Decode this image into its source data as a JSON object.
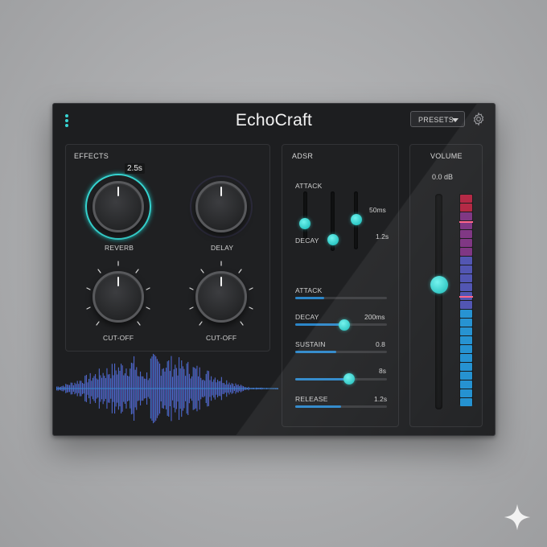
{
  "app": {
    "title": "EchoCraft"
  },
  "header": {
    "presets_label": "PRESETS"
  },
  "effects": {
    "title": "EFFECTS",
    "knobs": [
      {
        "label": "REVERB",
        "value_tooltip": "2.5s",
        "active": true
      },
      {
        "label": "DELAY",
        "active": false
      },
      {
        "label": "CUT-OFF",
        "active": false
      },
      {
        "label": "CUT-OFF",
        "active": false
      }
    ]
  },
  "adsr": {
    "title": "ADSR",
    "vertical": {
      "attack_label": "ATTACK",
      "decay_label": "DECAY",
      "value_a": "50ms",
      "value_b": "1.2s"
    },
    "sliders": [
      {
        "label": "ATTACK",
        "value": "",
        "fill": 0.32
      },
      {
        "label": "DECAY",
        "value": "200ms",
        "fill": 0.53
      },
      {
        "label": "SUSTAIN",
        "value": "0.8",
        "fill": 0.45
      },
      {
        "label": "",
        "value": "8s",
        "fill": 0.58
      },
      {
        "label": "RELEASE",
        "value": "1.2s",
        "fill": 0.5
      }
    ]
  },
  "volume": {
    "title": "VOLUME",
    "readout": "0.0 dB",
    "fader_level": 0.58
  },
  "colors": {
    "accent": "#36d4d0",
    "meter_low": "#1f8fd0",
    "meter_mid": "#4b4fb0",
    "meter_high": "#b01f3c"
  },
  "icons": {
    "menu": "vertical-dots-icon",
    "settings": "gear-icon",
    "dropdown": "chevron-down-icon"
  }
}
